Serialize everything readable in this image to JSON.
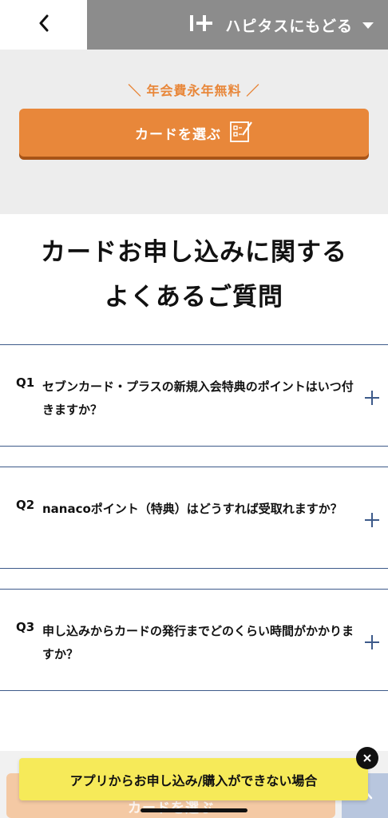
{
  "header": {
    "return_label": "ハピタスにもどる",
    "back_icon": "chevron-left-icon",
    "logo_icon": "hapitas-logo-icon",
    "caret_icon": "caret-down-icon"
  },
  "promo": {
    "slash_left": "＼",
    "tag": "年会費永年無料",
    "slash_right": "／",
    "button_label": "カードを選ぶ",
    "button_icon": "checklist-icon",
    "accent_color": "#e8873a"
  },
  "faq": {
    "title_line1": "カードお申し込みに関する",
    "title_line2": "よくあるご質問",
    "items": [
      {
        "num": "Q1",
        "question": "セブンカード・プラスの新規入会特典のポイントはいつ付きますか？"
      },
      {
        "num": "Q2",
        "question": "nanacoポイント（特典）はどうすれば受取れますか？"
      },
      {
        "num": "Q3",
        "question": "申し込みからカードの発行までどのくらい時間がかかりますか？"
      }
    ],
    "expand_icon": "plus-icon",
    "line_color": "#3d5a8a"
  },
  "bottom": {
    "ghost_button_label": "カードを選ぶ",
    "banner_label": "アプリからお申し込み/購入ができない場合",
    "close_icon": "close-icon",
    "scroll_top_icon": "chevron-up-icon",
    "banner_color": "#f6ea59"
  }
}
